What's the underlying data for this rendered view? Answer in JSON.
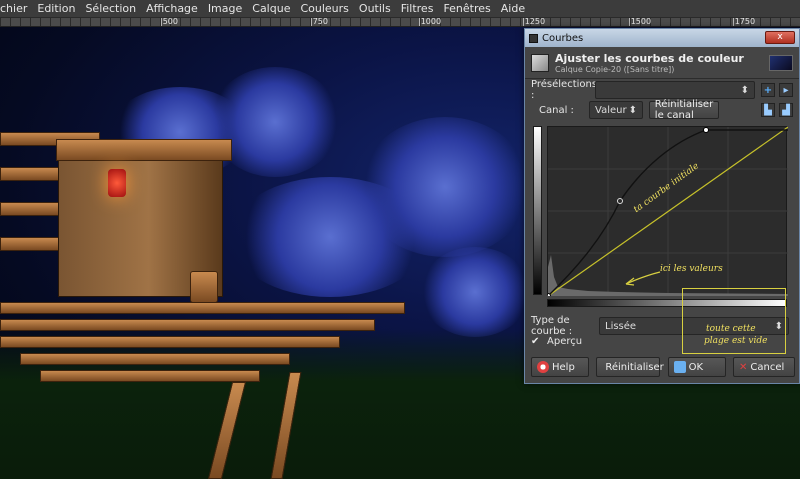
{
  "menu": [
    "chier",
    "Edition",
    "Sélection",
    "Affichage",
    "Image",
    "Calque",
    "Couleurs",
    "Outils",
    "Filtres",
    "Fenêtres",
    "Aide"
  ],
  "ruler": [
    "|500",
    "|750",
    "|1000",
    "|1250",
    "|1500",
    "|1750"
  ],
  "dialog": {
    "window_title": "Courbes",
    "close_label": "x",
    "title": "Ajuster les courbes de couleur",
    "subtitle": "Calque Copie-20 ([Sans titre])",
    "presets_label": "Présélections :",
    "channel_label": "Canal :",
    "channel_value": "Valeur",
    "reset_channel_label": "Réinitialiser le canal",
    "curve_type_label": "Type de courbe :",
    "curve_type_value": "Lissée",
    "preview_label": "Aperçu",
    "buttons": {
      "help": "Help",
      "reset": "Réinitialiser",
      "ok": "OK",
      "cancel": "Cancel"
    }
  },
  "annotations": {
    "curve": "ta courbe initiale",
    "values": "ici les valeurs",
    "empty_line1": "toute cette",
    "empty_line2": "plage est vide"
  },
  "colors": {
    "annotation": "#d8d040",
    "titlebar": "#9fb4cc",
    "dialog_bg": "#454545"
  }
}
